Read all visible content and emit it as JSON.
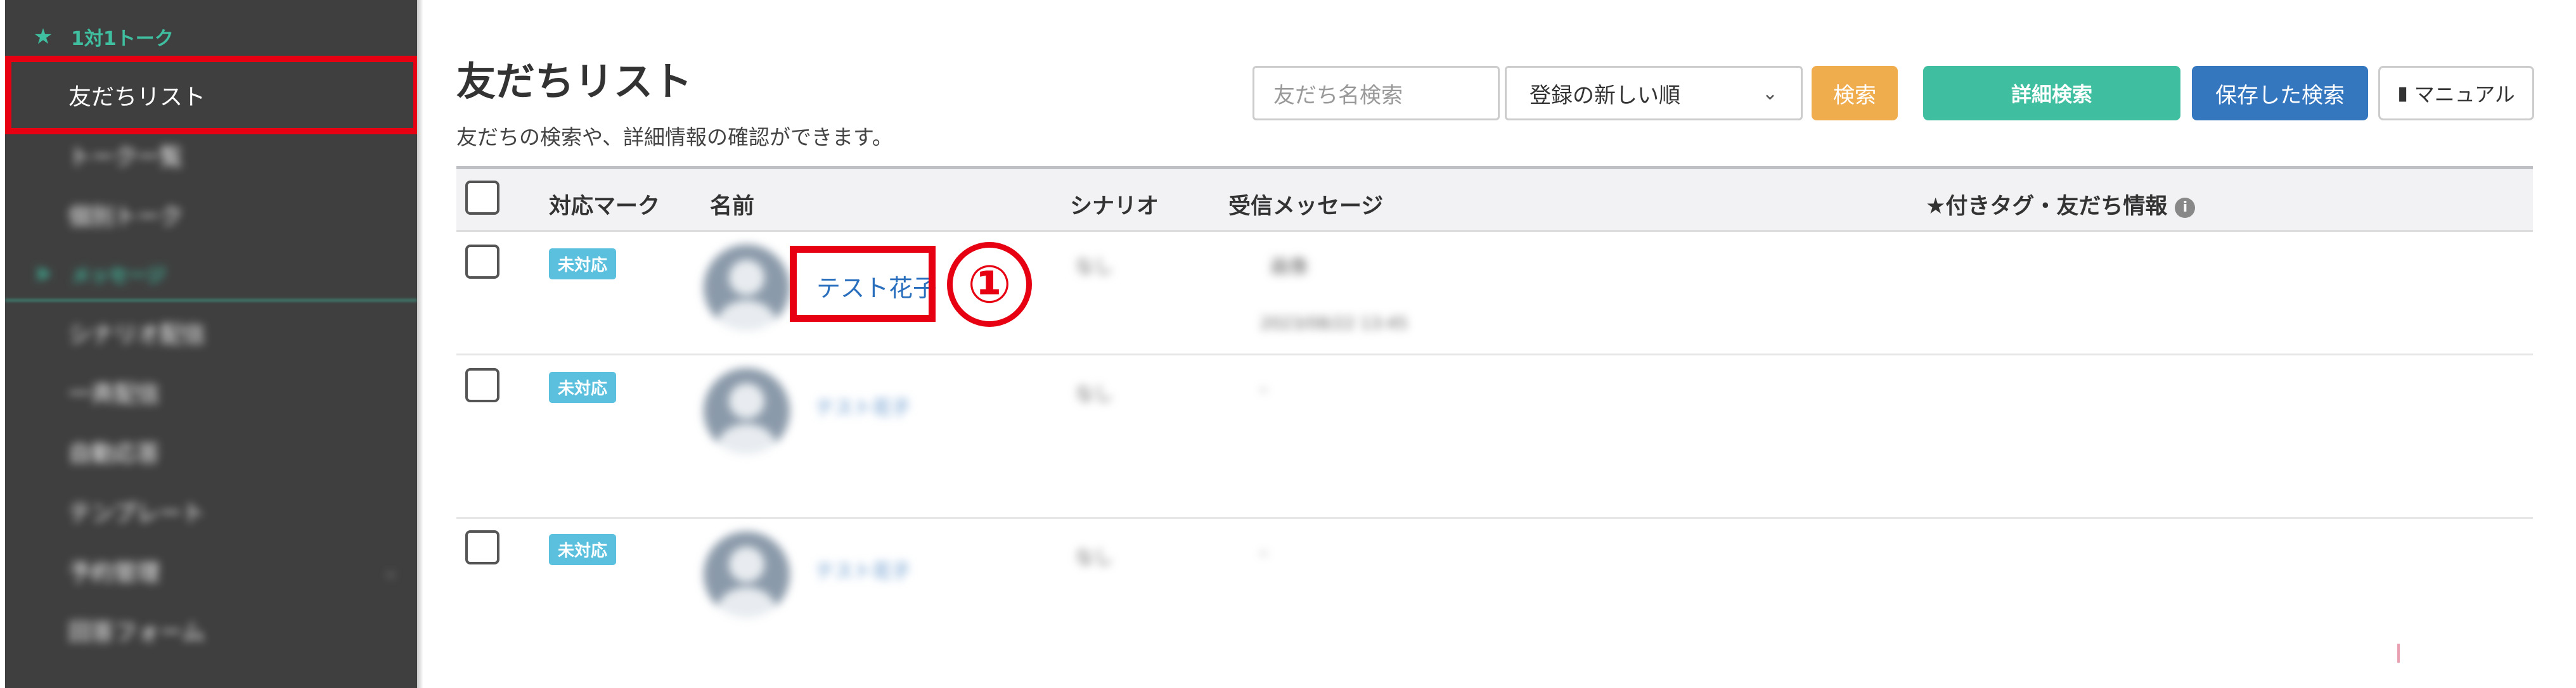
{
  "sidebar": {
    "category_1": {
      "icon": "star-icon",
      "label": "1対1トーク"
    },
    "items_1": [
      "友だちリスト",
      "トーク一覧",
      "個別トーク"
    ],
    "category_2": {
      "icon": "send-icon",
      "label": "メッセージ"
    },
    "items_2": [
      "シナリオ配信",
      "一斉配信",
      "自動応答",
      "テンプレート",
      "予約管理",
      "回答フォーム"
    ]
  },
  "header": {
    "title": "友だちリスト",
    "subtitle": "友だちの検索や、詳細情報の確認ができます。"
  },
  "toolbar": {
    "search_placeholder": "友だち名検索",
    "sort_selected": "登録の新しい順",
    "search_label": "検索",
    "detail_search_label": "詳細検索",
    "saved_search_label": "保存した検索",
    "manual_label": "マニュアル",
    "manual_icon": "book-icon"
  },
  "table": {
    "columns": {
      "status": "対応マーク",
      "name": "名前",
      "scenario": "シナリオ",
      "received": "受信メッセージ",
      "tags": "★付きタグ・友だち情報"
    },
    "rows": [
      {
        "status": "未対応",
        "name": "テスト花子",
        "scenario": "なし",
        "message": "画像",
        "date": "2023/08/22 13:45"
      },
      {
        "status": "未対応",
        "name": "テスト花子",
        "scenario": "なし",
        "message": "-"
      },
      {
        "status": "未対応",
        "name": "テスト花子",
        "scenario": "なし",
        "message": "-"
      }
    ]
  },
  "annotation": {
    "step_number": "①",
    "color": "#e60012"
  },
  "colors": {
    "sidebar_bg": "#3f3f3f",
    "accent_green": "#3fbfa0",
    "search_orange": "#f0ad4e",
    "saved_blue": "#3577bf",
    "badge_blue": "#5bc0de",
    "link_blue": "#2a6fbd"
  }
}
